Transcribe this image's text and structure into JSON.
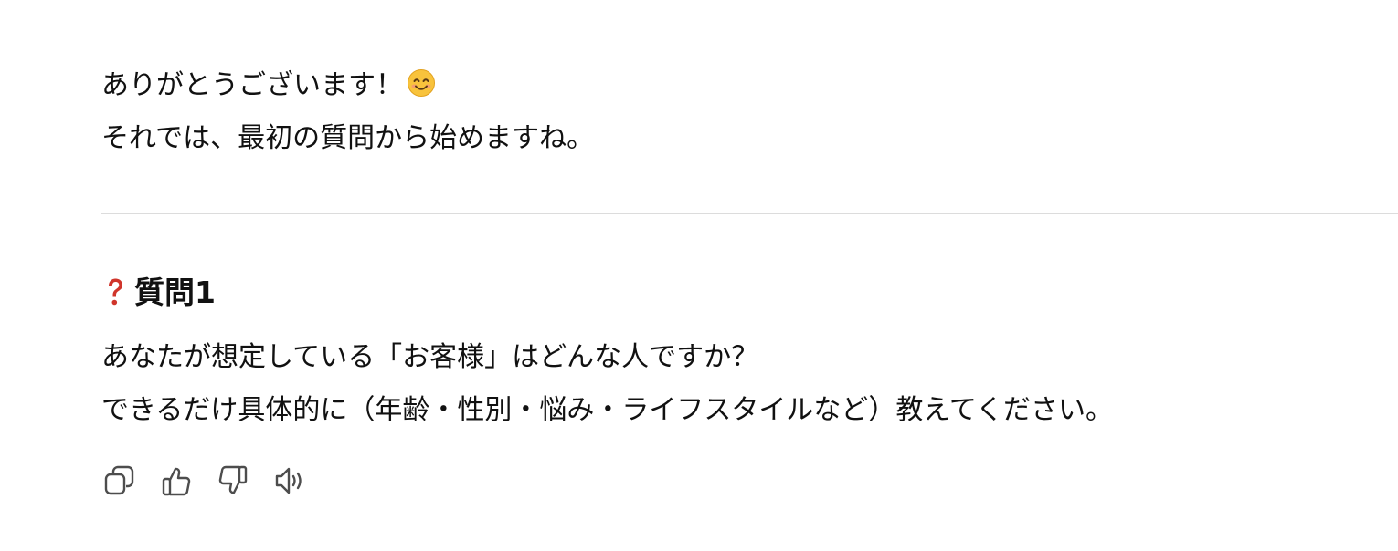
{
  "message": {
    "greeting": "ありがとうございます！",
    "greeting_emoji": "smiling-face-icon",
    "intro": "それでは、最初の質問から始めますね。"
  },
  "question": {
    "icon": "red-question-mark-icon",
    "title": "質問1",
    "line1": "あなたが想定している「お客様」はどんな人ですか？",
    "line2": "できるだけ具体的に（年齢・性別・悩み・ライフスタイルなど）教えてください。"
  },
  "actions": [
    {
      "icon": "copy-icon"
    },
    {
      "icon": "thumbs-up-icon"
    },
    {
      "icon": "thumbs-down-icon"
    },
    {
      "icon": "read-aloud-icon"
    }
  ],
  "colors": {
    "text": "#111111",
    "divider": "#dcdcdc",
    "icon": "#4d4d4d",
    "question_mark": "#d0352b"
  }
}
